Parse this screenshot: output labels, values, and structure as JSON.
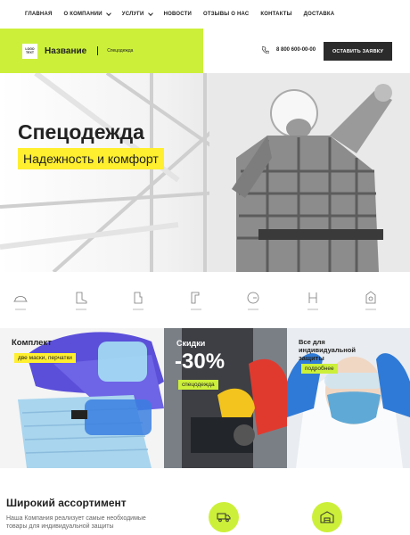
{
  "nav": {
    "items": [
      {
        "label": "ГЛАВНАЯ",
        "dropdown": false
      },
      {
        "label": "О КОМПАНИИ",
        "dropdown": true
      },
      {
        "label": "УСЛУГИ",
        "dropdown": true
      },
      {
        "label": "НОВОСТИ",
        "dropdown": false
      },
      {
        "label": "ОТЗЫВЫ О НАС",
        "dropdown": false
      },
      {
        "label": "КОНТАКТЫ",
        "dropdown": false
      },
      {
        "label": "ДОСТАВКА",
        "dropdown": false
      }
    ]
  },
  "header": {
    "logo_text": "LOGO TEXT",
    "company_name": "Название",
    "tagline": "Спецодежда",
    "phone": "8 800 600-00-00",
    "cta_label": "ОСТАВИТЬ ЗАЯВКУ"
  },
  "hero": {
    "title": "Спецодежда",
    "subtitle": "Надежность и комфорт"
  },
  "features": {
    "icons": [
      "helmet-icon",
      "boots-icon",
      "gloves-icon",
      "jacket-icon",
      "mask-icon",
      "overalls-icon",
      "glasses-icon"
    ]
  },
  "promos": [
    {
      "title": "Комплект",
      "tag": "две маски, перчатки"
    },
    {
      "title": "Скидки",
      "discount": "-30%",
      "tag": "спецодежда"
    },
    {
      "title": "Все для индивидуальной защиты",
      "tag": "подробнее"
    }
  ],
  "assortment": {
    "title": "Широкий ассортимент",
    "text": "Наша Компания реализует самые необходимые товары для индивидуальной защиты"
  },
  "colors": {
    "accent_green": "#ccf03a",
    "accent_yellow": "#ffef2e",
    "dark": "#2b2b2b"
  }
}
